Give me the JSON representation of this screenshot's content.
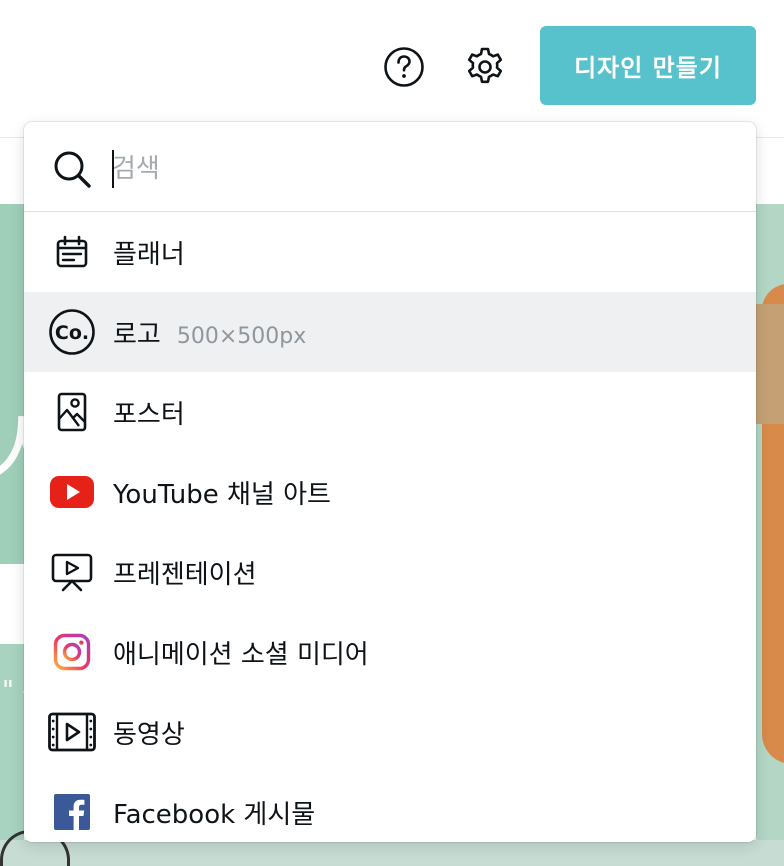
{
  "header": {
    "help_icon": "help-circle-icon",
    "settings_icon": "gear-icon",
    "create_button_label": "디자인 만들기",
    "create_button_color": "#57c2cb"
  },
  "dropdown": {
    "search": {
      "placeholder": "검색",
      "value": ""
    },
    "items": [
      {
        "label": "플래너",
        "dimension": "",
        "icon": "planner-icon"
      },
      {
        "label": "로고",
        "dimension": "500×500px",
        "icon": "logo-co-icon"
      },
      {
        "label": "포스터",
        "dimension": "",
        "icon": "poster-icon"
      },
      {
        "label": "YouTube 채널 아트",
        "dimension": "",
        "icon": "youtube-icon"
      },
      {
        "label": "프레젠테이션",
        "dimension": "",
        "icon": "presentation-icon"
      },
      {
        "label": "애니메이션 소셜 미디어",
        "dimension": "",
        "icon": "instagram-icon"
      },
      {
        "label": "동영상",
        "dimension": "",
        "icon": "video-icon"
      },
      {
        "label": "Facebook 게시물",
        "dimension": "",
        "icon": "facebook-icon"
      }
    ],
    "hover_row_color": "#eef0f2"
  },
  "colors": {
    "youtube_red": "#e62117",
    "facebook_blue": "#3b5998",
    "background_green": "#9fcfb8"
  }
}
